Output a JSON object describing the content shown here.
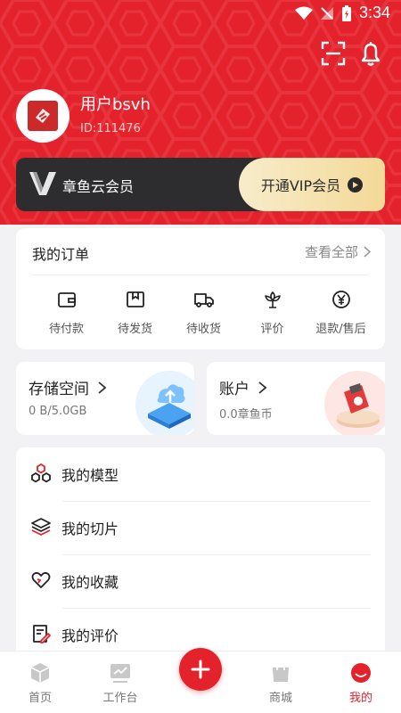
{
  "status_bar": {
    "time": "3:34"
  },
  "user": {
    "name": "用户bsvh",
    "id": "ID:111476"
  },
  "vip": {
    "name": "章鱼云会员",
    "button_label": "开通VIP会员"
  },
  "orders": {
    "title": "我的订单",
    "view_all": "查看全部",
    "items": [
      {
        "label": "待付款",
        "icon": "wallet-icon"
      },
      {
        "label": "待发货",
        "icon": "package-icon"
      },
      {
        "label": "待收货",
        "icon": "truck-icon"
      },
      {
        "label": "评价",
        "icon": "flower-icon"
      },
      {
        "label": "退款/售后",
        "icon": "yen-refund-icon"
      }
    ]
  },
  "storage": {
    "title": "存储空间",
    "value": "0 B/5.0GB"
  },
  "account": {
    "title": "账户",
    "value": "0.0章鱼币"
  },
  "menu": [
    {
      "label": "我的模型",
      "icon": "models-icon"
    },
    {
      "label": "我的切片",
      "icon": "layers-icon"
    },
    {
      "label": "我的收藏",
      "icon": "heart-icon"
    },
    {
      "label": "我的评价",
      "icon": "review-icon"
    }
  ],
  "tabbar": [
    {
      "label": "首页",
      "icon": "cube-icon",
      "active": false
    },
    {
      "label": "工作台",
      "icon": "workbench-icon",
      "active": false
    },
    {
      "label": "商城",
      "icon": "shop-bag-icon",
      "active": false
    },
    {
      "label": "我的",
      "icon": "profile-icon",
      "active": true
    }
  ],
  "colors": {
    "brand_red": "#e3222b",
    "vip_dark": "#2d2d30",
    "vip_gold": "#f3d997"
  }
}
